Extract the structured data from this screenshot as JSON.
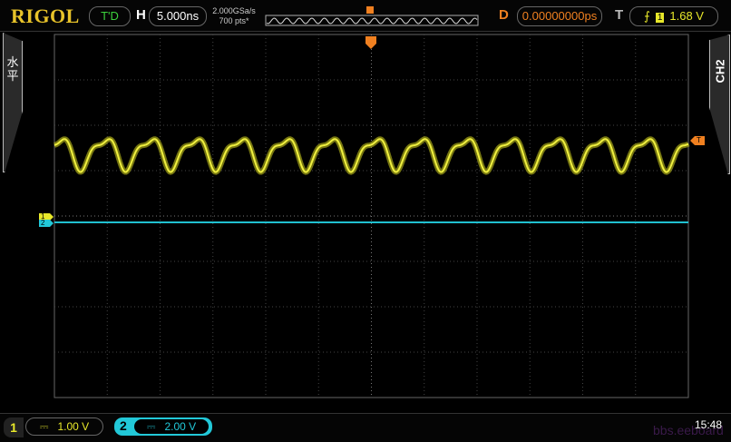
{
  "brand": "RIGOL",
  "run_state": "T'D",
  "horizontal": {
    "label": "H",
    "timebase": "5.000ns",
    "sample_rate": "2.000GSa/s",
    "memory_depth": "700  pts*"
  },
  "delay": {
    "label": "D",
    "value": "0.00000000ps"
  },
  "trigger": {
    "label": "T",
    "slope_icon": "rising-edge-icon",
    "source": "1",
    "level": "1.68 V",
    "marker": "T"
  },
  "left_panel": {
    "label_line1": "水",
    "label_line2": "平"
  },
  "right_panel": {
    "label": "CH2"
  },
  "channels": [
    {
      "number": "1",
      "coupling": "⎓",
      "scale": "1.00 V",
      "color": "#e8e82a"
    },
    {
      "number": "2",
      "coupling": "⎓",
      "scale": "2.00 V",
      "color": "#22c8d8"
    }
  ],
  "clock": "15:48",
  "watermark": "bbs.eeboard",
  "colors": {
    "ch1": "#d8d820",
    "ch2": "#20c0d0",
    "trigger": "#f08020",
    "grid": "#555555"
  }
}
